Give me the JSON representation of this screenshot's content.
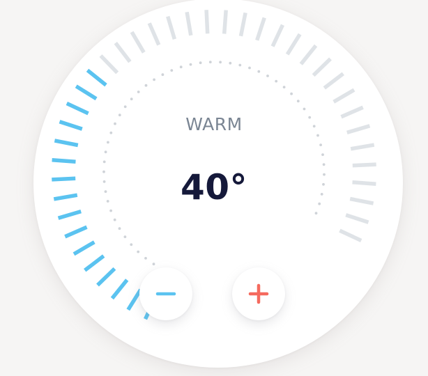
{
  "thermostat": {
    "mode": "WARM",
    "temperature": "40°",
    "level_fraction": 0.4,
    "tick_count": 40,
    "active_color": "#5bc3f0",
    "inactive_color": "#dfe3e7"
  },
  "controls": {
    "decrease_icon": "minus-icon",
    "increase_icon": "plus-icon",
    "decrease_color": "#5bc3f0",
    "increase_color": "#f56a5e"
  }
}
